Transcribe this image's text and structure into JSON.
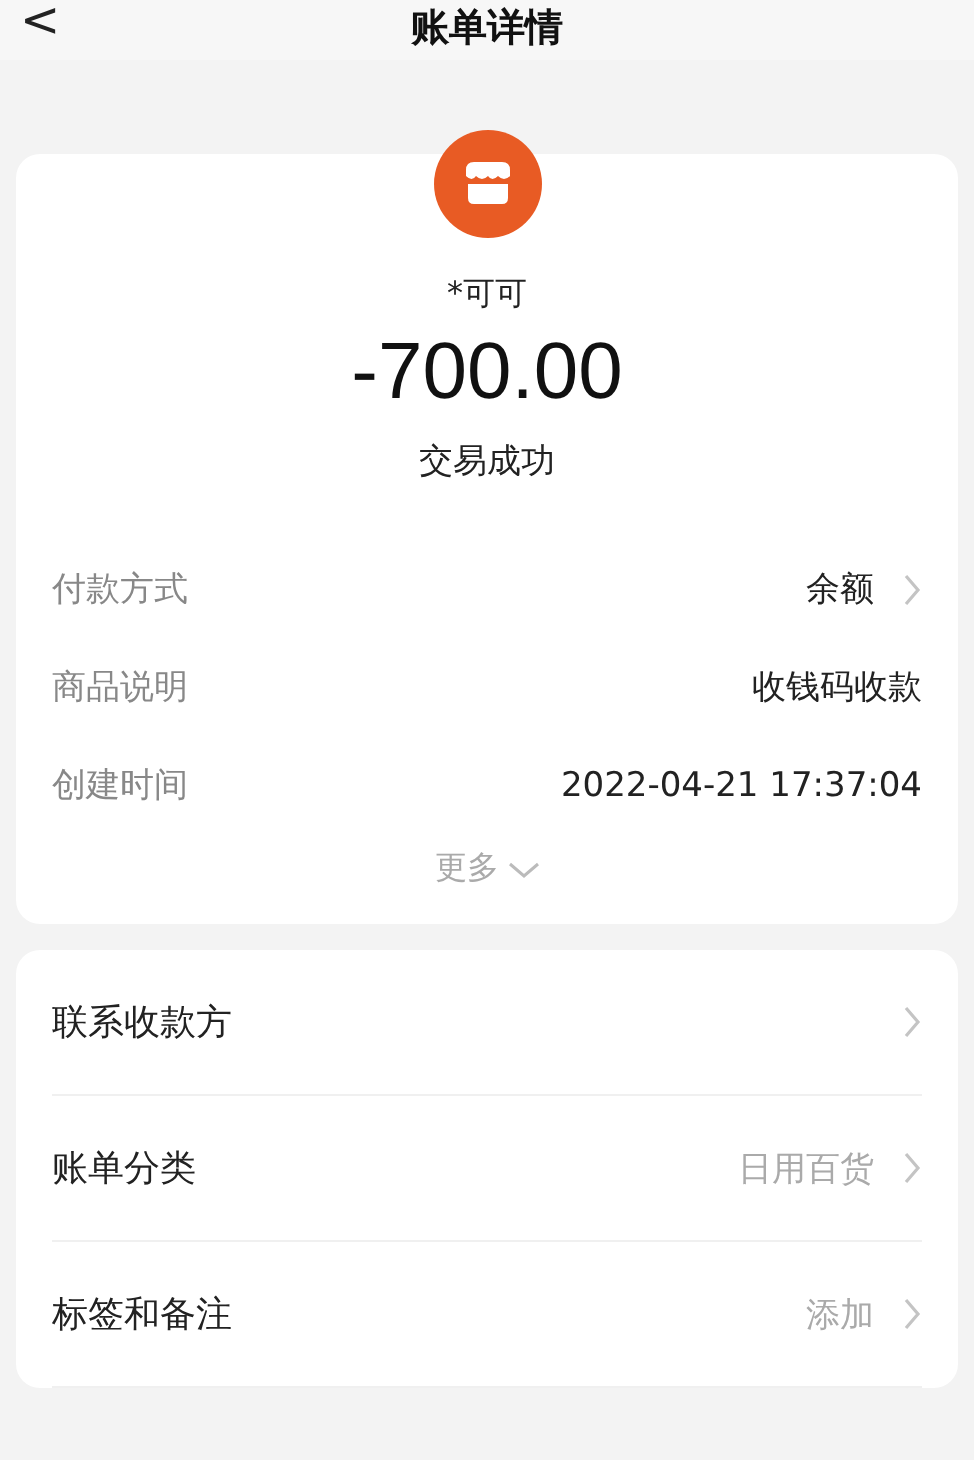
{
  "header": {
    "back": "<",
    "title": "账单详情"
  },
  "summary": {
    "merchant": "*可可",
    "amount": "-700.00",
    "status": "交易成功"
  },
  "details": [
    {
      "label": "付款方式",
      "value": "余额",
      "has_arrow": true
    },
    {
      "label": "商品说明",
      "value": "收钱码收款",
      "has_arrow": false
    },
    {
      "label": "创建时间",
      "value": "2022-04-21 17:37:04",
      "has_arrow": false
    }
  ],
  "more": "更多",
  "actions": [
    {
      "label": "联系收款方",
      "has_arrow": true
    },
    {
      "label": "账单分类",
      "value": "日用百货",
      "has_arrow": true
    },
    {
      "label": "标签和备注",
      "value": "添加",
      "has_arrow": true
    }
  ]
}
